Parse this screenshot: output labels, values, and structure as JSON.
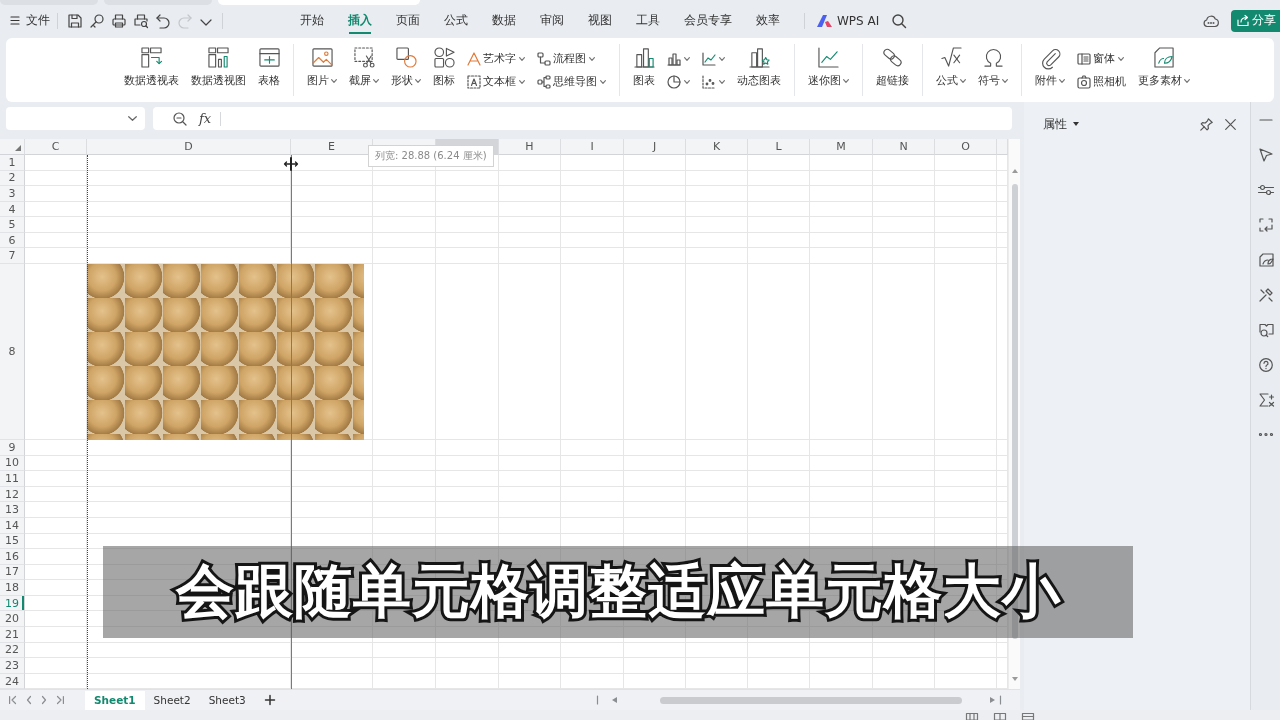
{
  "document_tabs": [
    {
      "selected": false
    },
    {
      "selected": false
    },
    {
      "selected": true
    }
  ],
  "title_bar": {
    "file_menu": "文件",
    "quick_access": [
      {
        "disabled": false
      },
      {
        "disabled": false
      },
      {
        "disabled": false
      },
      {
        "disabled": false
      },
      {
        "disabled": false
      },
      {
        "disabled": true
      },
      {
        "disabled": false
      }
    ],
    "menu_tabs": [
      {
        "label": "开始",
        "selected": false
      },
      {
        "label": "插入",
        "selected": true
      },
      {
        "label": "页面",
        "selected": false
      },
      {
        "label": "公式",
        "selected": false
      },
      {
        "label": "数据",
        "selected": false
      },
      {
        "label": "审阅",
        "selected": false
      },
      {
        "label": "视图",
        "selected": false
      },
      {
        "label": "工具",
        "selected": false
      },
      {
        "label": "会员专享",
        "selected": false
      },
      {
        "label": "效率",
        "selected": false
      }
    ],
    "ai_button": "WPS AI",
    "share_button": "分享"
  },
  "ribbon": {
    "groups": [
      {
        "items": [
          {
            "kind": "large",
            "label": "数据透视表",
            "dropdown": false
          },
          {
            "kind": "large",
            "label": "数据透视图",
            "dropdown": false
          },
          {
            "kind": "large",
            "label": "表格",
            "dropdown": false
          }
        ]
      },
      {
        "items": [
          {
            "kind": "large",
            "label": "图片",
            "dropdown": true
          },
          {
            "kind": "large",
            "label": "截屏",
            "dropdown": true
          },
          {
            "kind": "large",
            "label": "形状",
            "dropdown": true
          },
          {
            "kind": "large",
            "label": "图标",
            "dropdown": false
          },
          {
            "kind": "stack",
            "rows": [
              {
                "label": "艺术字",
                "dropdown": true
              },
              {
                "label": "文本框",
                "dropdown": true
              }
            ]
          },
          {
            "kind": "stack",
            "rows": [
              {
                "label": "流程图",
                "dropdown": true
              },
              {
                "label": "思维导图",
                "dropdown": true
              }
            ]
          }
        ]
      },
      {
        "items": [
          {
            "kind": "large",
            "label": "图表",
            "dropdown": false
          },
          {
            "kind": "stack",
            "rows": [
              {
                "dropdown": true
              },
              {
                "dropdown": true
              }
            ]
          },
          {
            "kind": "stack",
            "rows": [
              {
                "dropdown": true
              },
              {
                "dropdown": true
              }
            ]
          },
          {
            "kind": "large",
            "label": "动态图表",
            "dropdown": false
          }
        ]
      },
      {
        "items": [
          {
            "kind": "large",
            "label": "迷你图",
            "dropdown": true
          }
        ]
      },
      {
        "items": [
          {
            "kind": "large",
            "label": "超链接",
            "dropdown": false
          }
        ]
      },
      {
        "items": [
          {
            "kind": "large",
            "label": "公式",
            "dropdown": true
          },
          {
            "kind": "large",
            "label": "符号",
            "dropdown": true
          }
        ]
      },
      {
        "items": [
          {
            "kind": "large",
            "label": "附件",
            "dropdown": true
          },
          {
            "kind": "stack",
            "rows": [
              {
                "label": "窗体",
                "dropdown": true
              },
              {
                "label": "照相机",
                "dropdown": false
              }
            ]
          },
          {
            "kind": "large",
            "label": "更多素材",
            "dropdown": true
          }
        ]
      }
    ]
  },
  "formula_bar": {
    "function_label": "fx"
  },
  "sheet": {
    "columns": [
      {
        "label": "C",
        "highlighted": false
      },
      {
        "label": "D",
        "highlighted": false
      },
      {
        "label": "E",
        "highlighted": false
      },
      {
        "highlighted": false
      },
      {
        "highlighted": true
      },
      {
        "label": "H",
        "highlighted": false
      },
      {
        "label": "I",
        "highlighted": false
      },
      {
        "label": "J",
        "highlighted": false
      },
      {
        "label": "K",
        "highlighted": false
      },
      {
        "label": "L",
        "highlighted": false
      },
      {
        "label": "M",
        "highlighted": false
      },
      {
        "label": "N",
        "highlighted": false
      },
      {
        "label": "O",
        "highlighted": false
      },
      {
        "highlighted": false
      }
    ],
    "rows": [
      {
        "label": "1",
        "selected": false
      },
      {
        "label": "2",
        "selected": false
      },
      {
        "label": "3",
        "selected": false
      },
      {
        "label": "4",
        "selected": false
      },
      {
        "label": "5",
        "selected": false
      },
      {
        "label": "6",
        "selected": false
      },
      {
        "label": "7",
        "selected": false
      },
      {
        "label": "8",
        "selected": false
      },
      {
        "label": "9",
        "selected": false
      },
      {
        "label": "10",
        "selected": false
      },
      {
        "label": "11",
        "selected": false
      },
      {
        "label": "12",
        "selected": false
      },
      {
        "label": "13",
        "selected": false
      },
      {
        "label": "14",
        "selected": false
      },
      {
        "label": "15",
        "selected": false
      },
      {
        "label": "16",
        "selected": false
      },
      {
        "label": "17",
        "selected": false
      },
      {
        "label": "18",
        "selected": false
      },
      {
        "label": "19",
        "selected": true
      },
      {
        "label": "20",
        "selected": false
      },
      {
        "label": "21",
        "selected": false
      },
      {
        "label": "22",
        "selected": false
      },
      {
        "label": "23",
        "selected": false
      },
      {
        "label": "24",
        "selected": false
      }
    ],
    "tooltip": "列宽: 28.88 (6.24 厘米)"
  },
  "properties_panel": {
    "title": "属性"
  },
  "sheet_tabs": [
    {
      "label": "Sheet1",
      "selected": true
    },
    {
      "label": "Sheet2",
      "selected": false
    },
    {
      "label": "Sheet3",
      "selected": false
    }
  ],
  "subtitle": "会跟随单元格调整适应单元格大小"
}
